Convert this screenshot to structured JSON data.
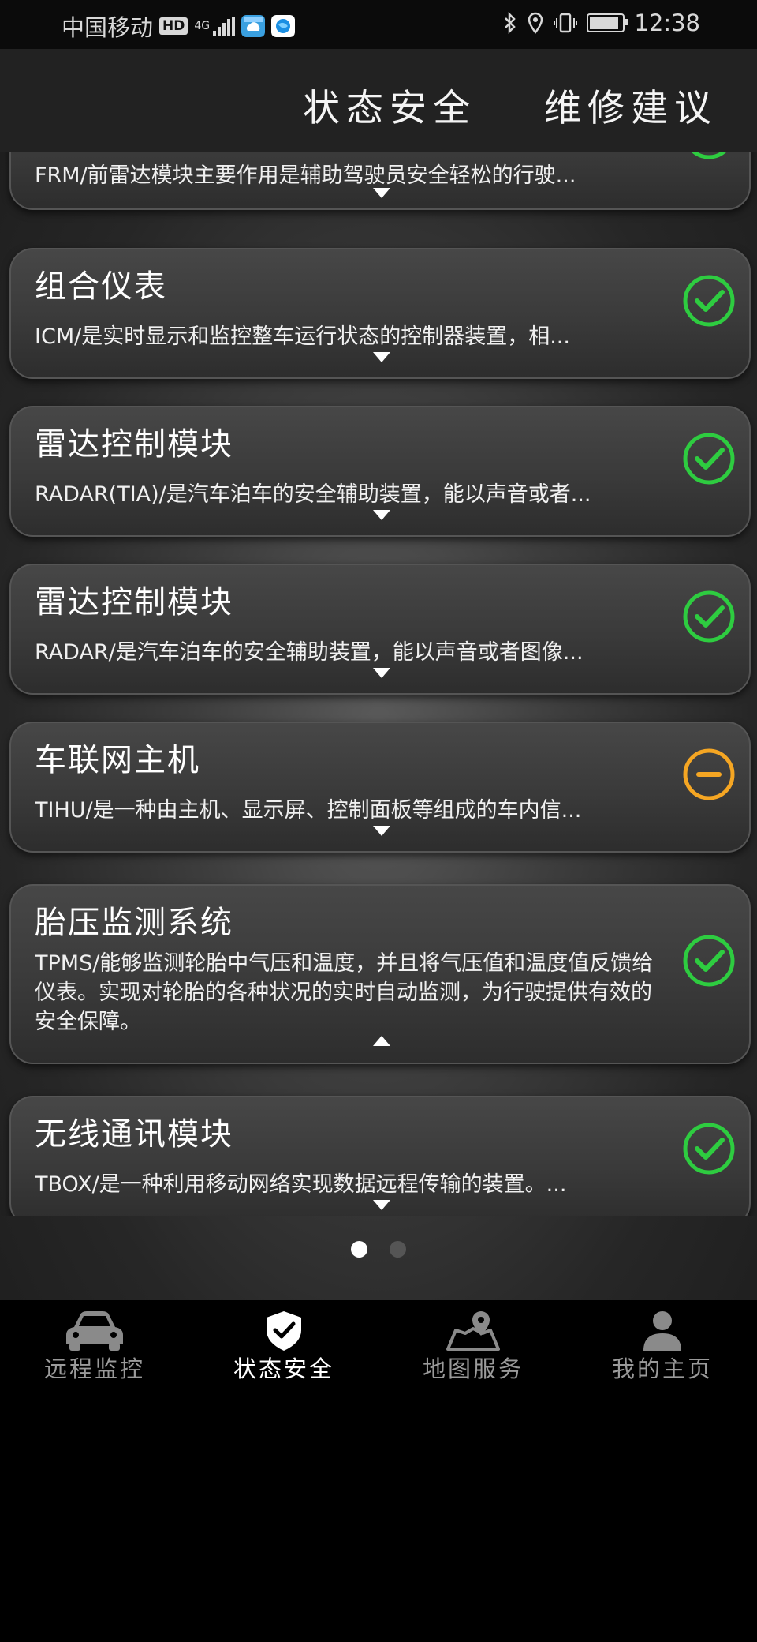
{
  "status_bar": {
    "carrier": "中国移动",
    "hd": "HD",
    "network": "4G",
    "time": "12:38"
  },
  "tabs": [
    {
      "label": "状态安全",
      "active": true
    },
    {
      "label": "维修建议",
      "active": false
    }
  ],
  "modules": [
    {
      "title": "",
      "desc": "FRM/前雷达模块主要作用是辅助驾驶员安全轻松的行驶...",
      "status": "ok",
      "expanded": false
    },
    {
      "title": "组合仪表",
      "desc": "ICM/是实时显示和监控整车运行状态的控制器装置，相...",
      "status": "ok",
      "expanded": false
    },
    {
      "title": "雷达控制模块",
      "desc": "RADAR(TIA)/是汽车泊车的安全辅助装置，能以声音或者...",
      "status": "ok",
      "expanded": false
    },
    {
      "title": "雷达控制模块",
      "desc": "RADAR/是汽车泊车的安全辅助装置，能以声音或者图像...",
      "status": "ok",
      "expanded": false
    },
    {
      "title": "车联网主机",
      "desc": "TIHU/是一种由主机、显示屏、控制面板等组成的车内信...",
      "status": "warning",
      "expanded": false
    },
    {
      "title": "胎压监测系统",
      "desc": "TPMS/能够监测轮胎中气压和温度，并且将气压值和温度值反馈给仪表。实现对轮胎的各种状况的实时自动监测，为行驶提供有效的安全保障。",
      "status": "ok",
      "expanded": true
    },
    {
      "title": "无线通讯模块",
      "desc": "TBOX/是一种利用移动网络实现数据远程传输的装置。...",
      "status": "ok",
      "expanded": false
    }
  ],
  "pager": {
    "pages": 2,
    "current": 1
  },
  "bottom_nav": [
    {
      "label": "远程监控",
      "icon": "car-icon",
      "active": false
    },
    {
      "label": "状态安全",
      "icon": "shield-check-icon",
      "active": true
    },
    {
      "label": "地图服务",
      "icon": "map-pin-icon",
      "active": false
    },
    {
      "label": "我的主页",
      "icon": "person-icon",
      "active": false
    }
  ],
  "colors": {
    "ok": "#2ecc40",
    "warning": "#f5a623",
    "accent_text": "#ffffff",
    "nav_inactive": "#9a9a9a"
  }
}
